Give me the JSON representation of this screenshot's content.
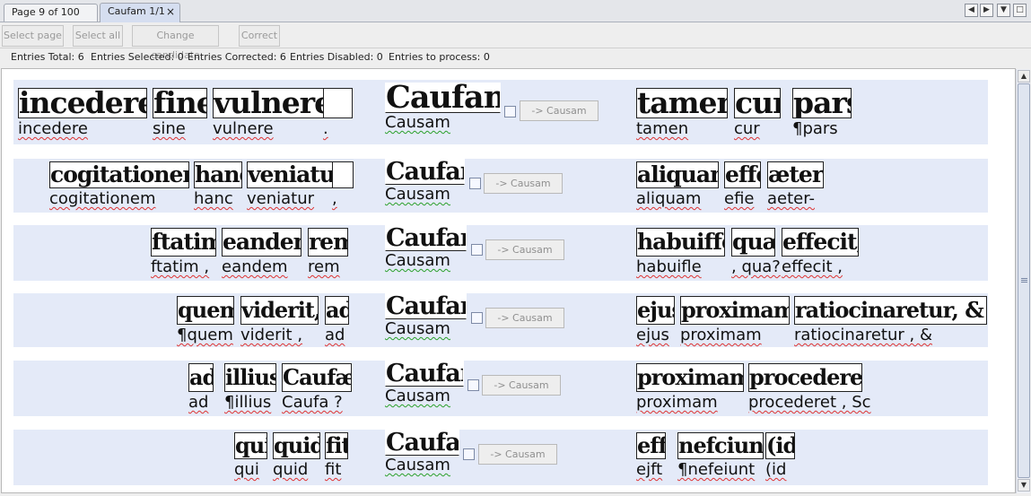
{
  "tabs": [
    {
      "label": "Page 9 of 100"
    },
    {
      "label": "Caufam 1/1",
      "close": "×"
    }
  ],
  "nav_icons": [
    "◀",
    "▶",
    "▼",
    "□"
  ],
  "toolbar": {
    "select_page": "Select page",
    "select_all": "Select all",
    "change_candidate": "Change candidate",
    "correct": "Correct"
  },
  "stats": {
    "total": "Entries Total: 6",
    "selected": "Entries Selected: 0",
    "corrected": "Entries Corrected: 6",
    "disabled": "Entries Disabled: 0",
    "to_process": "Entries to process: 0"
  },
  "candidate_label": "-> Causam",
  "entries": [
    {
      "left": [
        {
          "img": "incedere",
          "txt": "incedere"
        },
        {
          "img": "fine",
          "txt": "sine"
        },
        {
          "img": "vulnere",
          "txt": "vulnere"
        },
        {
          "img": "",
          "txt": "."
        }
      ],
      "center": {
        "img": "Caufam",
        "txt": "Causam"
      },
      "right": [
        {
          "img": "tamen",
          "txt": "tamen"
        },
        {
          "img": "cur",
          "txt": "cur"
        },
        {
          "img": "pars",
          "txt": "¶pars"
        }
      ]
    },
    {
      "left": [
        {
          "img": "cogitationem",
          "txt": "cogitationem"
        },
        {
          "img": "hanc",
          "txt": "hanc"
        },
        {
          "img": "veniatur,",
          "txt": "veniatur"
        },
        {
          "img": "",
          "txt": ","
        }
      ],
      "center": {
        "img": "Caufam",
        "txt": "Causam"
      },
      "right": [
        {
          "img": "aliquam",
          "txt": "aliquam"
        },
        {
          "img": "effe",
          "txt": "efie"
        },
        {
          "img": "æter-",
          "txt": "aeter-"
        }
      ]
    },
    {
      "left": [
        {
          "img": "ftatim,",
          "txt": "ftatim ,"
        },
        {
          "img": "eandem",
          "txt": "eandem"
        },
        {
          "img": "rem",
          "txt": "rem"
        }
      ],
      "center": {
        "img": "Caufam",
        "txt": "Causam"
      },
      "right": [
        {
          "img": "habuiffe,",
          "txt": "habuifle"
        },
        {
          "img": "quæ",
          "txt": ", qua?"
        },
        {
          "img": "effecit,",
          "txt": "effecit ,"
        }
      ]
    },
    {
      "left": [
        {
          "img": "quem",
          "txt": "¶quem"
        },
        {
          "img": "viderit,",
          "txt": "viderit  ,"
        },
        {
          "img": "ad",
          "txt": "ad"
        }
      ],
      "center": {
        "img": "Caufam",
        "txt": "Causam"
      },
      "right": [
        {
          "img": "ejus",
          "txt": "ejus"
        },
        {
          "img": "proximam",
          "txt": "proximam"
        },
        {
          "img": "ratiocinaretur, &",
          "txt": "ratiocinaretur    , &"
        }
      ]
    },
    {
      "left": [
        {
          "img": "ad",
          "txt": "ad"
        },
        {
          "img": "illius",
          "txt": "¶illius"
        },
        {
          "img": "Caufæ",
          "txt": "Caufa ?"
        }
      ],
      "center": {
        "img": "Caufam",
        "txt": "Causam"
      },
      "right": [
        {
          "img": "proximam",
          "txt": "proximam"
        },
        {
          "img": "procederet, &",
          "txt": "procederet    , Sc"
        }
      ]
    },
    {
      "left": [
        {
          "img": "qui",
          "txt": "qui"
        },
        {
          "img": "quid",
          "txt": "quid"
        },
        {
          "img": "fit",
          "txt": "fit"
        }
      ],
      "center": {
        "img": "Caufam",
        "txt": "Causam"
      },
      "right": [
        {
          "img": "effe",
          "txt": "ejft"
        },
        {
          "img": "nefciunt",
          "txt": "¶nefeiunt"
        },
        {
          "img": "(id",
          "txt": "(id"
        }
      ]
    }
  ]
}
